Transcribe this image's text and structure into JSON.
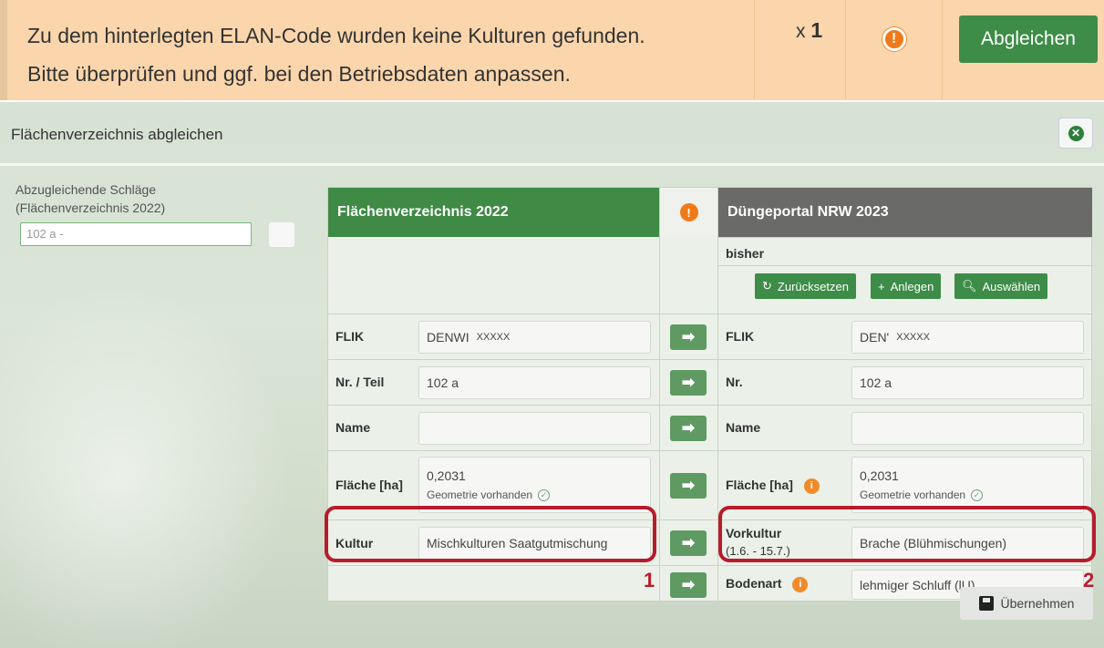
{
  "banner": {
    "message_line1": "Zu dem hinterlegten ELAN-Code wurden keine Kulturen gefunden.",
    "message_line2": "Bitte überprüfen und ggf. bei den Betriebsdaten anpassen.",
    "count_prefix": "x",
    "count": "1",
    "warn_symbol": "!",
    "action_label": "Abgleichen"
  },
  "dialog": {
    "title": "Flächenverzeichnis abgleichen",
    "close_symbol": "✕",
    "sidebar": {
      "label_line1": "Abzugleichende Schläge",
      "label_line2": "(Flächenverzeichnis 2022)",
      "input_value": "102 a -"
    },
    "left_header": "Flächenverzeichnis 2022",
    "right_header": "Düngeportal NRW 2023",
    "mid_warn_symbol": "!",
    "bisher_label": "bisher",
    "buttons": {
      "reset": "Zurücksetzen",
      "add": "Anlegen",
      "select": "Auswählen"
    },
    "rows": {
      "flik": {
        "left_label": "FLIK",
        "left_value_prefix": "DENWI",
        "left_value_mask": "XXXXX",
        "right_label": "FLIK",
        "right_value_prefix": "DEN'",
        "right_value_mask": "XXXXX"
      },
      "nr": {
        "left_label": "Nr. / Teil",
        "left_value": "102 a",
        "right_label": "Nr.",
        "right_value": "102 a"
      },
      "name": {
        "left_label": "Name",
        "left_value": "",
        "right_label": "Name",
        "right_value": ""
      },
      "flaeche": {
        "left_label": "Fläche [ha]",
        "left_value": "0,2031",
        "left_note": "Geometrie vorhanden",
        "right_label": "Fläche [ha]",
        "right_value": "0,2031",
        "right_note": "Geometrie vorhanden"
      },
      "kultur": {
        "left_label": "Kultur",
        "left_value": "Mischkulturen Saatgutmischung",
        "right_label_line1": "Vorkultur",
        "right_label_line2": "(1.6. - 15.7.)",
        "right_value": "Brache (Blühmischungen)"
      },
      "bodenart": {
        "right_label": "Bodenart",
        "right_value": "lehmiger Schluff (lU)"
      }
    },
    "markers": {
      "one": "1",
      "two": "2"
    },
    "save_label": "Übernehmen"
  },
  "colors": {
    "banner_bg": "#fbd6ac",
    "green": "#3f8a45",
    "grey_header": "#6a6a68",
    "warning_orange": "#f07a1a",
    "highlight_red": "#b71c2c"
  }
}
